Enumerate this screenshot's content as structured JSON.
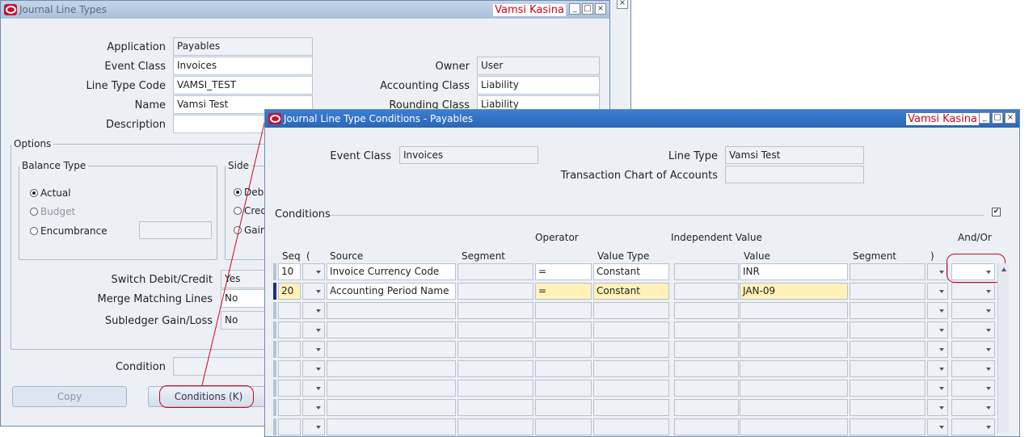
{
  "back_window": {
    "title": "Journal Line Types",
    "user": "Vamsi Kasina",
    "fields": {
      "application_label": "Application",
      "application_value": "Payables",
      "event_class_label": "Event Class",
      "event_class_value": "Invoices",
      "line_type_code_label": "Line Type Code",
      "line_type_code_value": "VAMSI_TEST",
      "name_label": "Name",
      "name_value": "Vamsi Test",
      "description_label": "Description",
      "description_value": "",
      "owner_label": "Owner",
      "owner_value": "User",
      "accounting_class_label": "Accounting Class",
      "accounting_class_value": "Liability",
      "rounding_class_label": "Rounding Class",
      "rounding_class_value": "Liability"
    },
    "options_legend": "Options",
    "balance_type": {
      "legend": "Balance Type",
      "actual": "Actual",
      "budget": "Budget",
      "encumbrance": "Encumbrance"
    },
    "side": {
      "legend": "Side",
      "debit": "Debi",
      "credit": "Cred",
      "gain": "Gair"
    },
    "switch_label": "Switch Debit/Credit",
    "switch_value": "Yes",
    "merge_label": "Merge Matching Lines",
    "merge_value": "No",
    "gainloss_label": "Subledger Gain/Loss",
    "gainloss_value": "No",
    "condition_label": "Condition",
    "condition_value": "",
    "copy_button": "Copy",
    "conditions_button": "Conditions (K)"
  },
  "front_window": {
    "title": "Journal Line Type Conditions - Payables",
    "user": "Vamsi Kasina",
    "event_class_label": "Event Class",
    "event_class_value": "Invoices",
    "line_type_label": "Line Type",
    "line_type_value": "Vamsi Test",
    "tca_label": "Transaction Chart of Accounts",
    "tca_value": "",
    "conditions_label": "Conditions",
    "headers": {
      "operator": "Operator",
      "independent_value": "Independent Value",
      "andor": "And/Or",
      "seq": "Seq",
      "open_paren": "(",
      "source": "Source",
      "segment": "Segment",
      "value_type": "Value Type",
      "value": "Value",
      "segment2": "Segment",
      "close_paren": ")"
    },
    "rows": [
      {
        "seq": "10",
        "source": "Invoice Currency Code",
        "operator": "=",
        "value_type": "Constant",
        "value": "INR"
      },
      {
        "seq": "20",
        "source": "Accounting Period Name",
        "operator": "=",
        "value_type": "Constant",
        "value": "JAN-09"
      }
    ]
  }
}
